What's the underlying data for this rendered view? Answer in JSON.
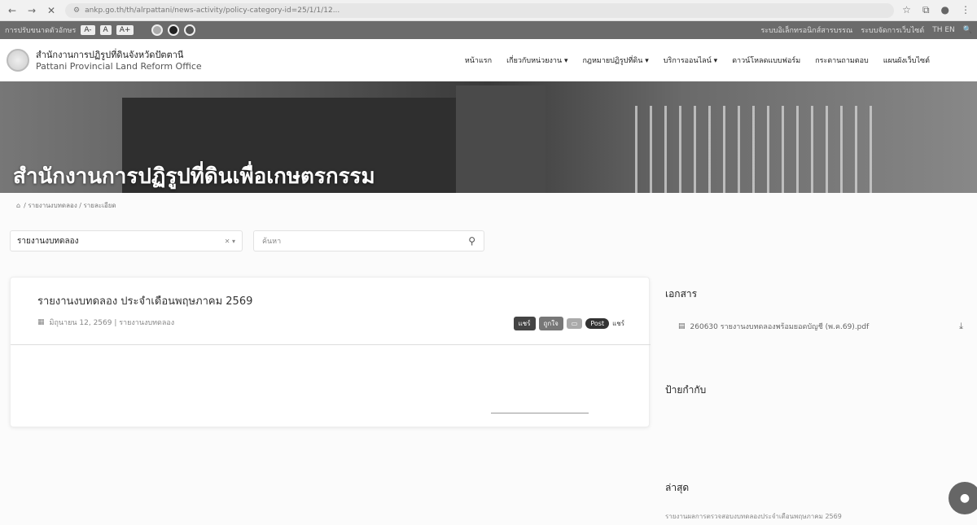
{
  "browser": {
    "url": "ankp.go.th/th/alrpattani/news-activity/policy-category-id=25/1/1/12...",
    "back_icon": "←",
    "forward_icon": "→",
    "reload_icon": "✕"
  },
  "accessibility": {
    "label": "การปรับขนาดตัวอักษร",
    "font_small": "A-",
    "font_normal": "A",
    "font_large": "A+",
    "right_link_1": "ระบบอิเล็กทรอนิกส์สารบรรณ",
    "right_link_2": "ระบบจัดการเว็บไซต์",
    "lang": "TH EN"
  },
  "header": {
    "org_name_th": "สำนักงานการปฏิรูปที่ดินจังหวัดปัตตานี",
    "org_name_en": "Pattani Provincial Land Reform Office",
    "nav": [
      "หน้าแรก",
      "เกี่ยวกับหน่วยงาน ▾",
      "กฎหมายปฏิรูปที่ดิน ▾",
      "บริการออนไลน์ ▾",
      "ดาวน์โหลดแบบฟอร์ม",
      "กระดานถามตอบ",
      "แผนผังเว็บไซต์"
    ]
  },
  "banner": {
    "title": "สำนักงานการปฏิรูปที่ดินเพื่อเกษตรกรรม"
  },
  "breadcrumb": {
    "home_icon": "⌂",
    "items": "/ รายงานงบทดลอง / รายละเอียด"
  },
  "filters": {
    "category": "รายงานงบทดลอง",
    "search_placeholder": "ค้นหา"
  },
  "article": {
    "title": "รายงานงบทดลอง ประจำเดือนพฤษภาคม 2569",
    "date": "มิถุนายน 12, 2569 | รายงานงบทดลอง",
    "share_facebook": "แชร์",
    "share_like": "ถูกใจ",
    "share_post": "Post",
    "share_label": "แชร์"
  },
  "sidebar": {
    "documents_heading": "เอกสาร",
    "document_name": "260630 รายงานงบทดลองพร้อมยอดบัญชี (พ.ค.69).pdf",
    "tags_heading": "ป้ายกำกับ",
    "latest_heading": "ล่าสุด",
    "latest_item": "รายงานผลการตรวจสอบงบทดลองประจำเดือนพฤษภาคม 2569"
  }
}
